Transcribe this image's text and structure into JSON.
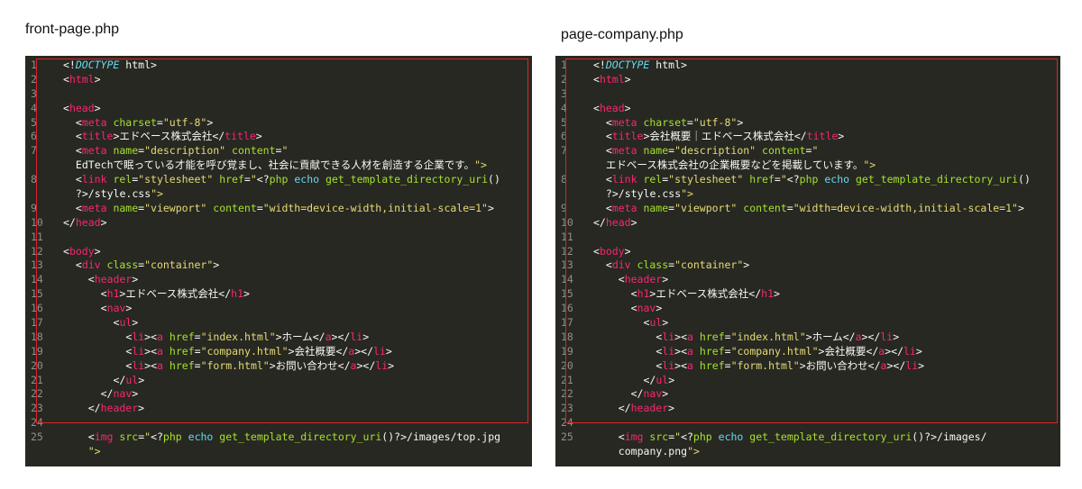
{
  "panels": [
    {
      "title": "front-page.php",
      "lines": [
        {
          "n": "1",
          "t": "<!DOCTYPE html>"
        },
        {
          "n": "2",
          "t": "<html>"
        },
        {
          "n": "3",
          "t": ""
        },
        {
          "n": "4",
          "t": "<head>"
        },
        {
          "n": "5",
          "t": "  <meta charset=\"utf-8\">"
        },
        {
          "n": "6",
          "t": "  <title>エドベース株式会社</title>"
        },
        {
          "n": "7",
          "t": "  <meta name=\"description\" content=\""
        },
        {
          "n": "",
          "t": "  EdTechで眠っている才能を呼び覚まし、社会に貢献できる人材を創造する企業です。\">"
        },
        {
          "n": "8",
          "t": "  <link rel=\"stylesheet\" href=\"<?php echo get_template_directory_uri()"
        },
        {
          "n": "",
          "t": "  ?>/style.css\">"
        },
        {
          "n": "9",
          "t": "  <meta name=\"viewport\" content=\"width=device-width,initial-scale=1\">"
        },
        {
          "n": "10",
          "t": "</head>"
        },
        {
          "n": "11",
          "t": ""
        },
        {
          "n": "12",
          "t": "<body>"
        },
        {
          "n": "13",
          "t": "  <div class=\"container\">"
        },
        {
          "n": "14",
          "t": "    <header>"
        },
        {
          "n": "15",
          "t": "      <h1>エドベース株式会社</h1>"
        },
        {
          "n": "16",
          "t": "      <nav>"
        },
        {
          "n": "17",
          "t": "        <ul>"
        },
        {
          "n": "18",
          "t": "          <li><a href=\"index.html\">ホーム</a></li>"
        },
        {
          "n": "19",
          "t": "          <li><a href=\"company.html\">会社概要</a></li>"
        },
        {
          "n": "20",
          "t": "          <li><a href=\"form.html\">お問い合わせ</a></li>"
        },
        {
          "n": "21",
          "t": "        </ul>"
        },
        {
          "n": "22",
          "t": "      </nav>"
        },
        {
          "n": "23",
          "t": "    </header>"
        },
        {
          "n": "24",
          "t": ""
        },
        {
          "n": "25",
          "t": "    <img src=\"<?php echo get_template_directory_uri()?>/images/top.jpg"
        },
        {
          "n": "",
          "t": "    \">"
        }
      ]
    },
    {
      "title": "page-company.php",
      "lines": [
        {
          "n": "1",
          "t": "<!DOCTYPE html>"
        },
        {
          "n": "2",
          "t": "<html>"
        },
        {
          "n": "3",
          "t": ""
        },
        {
          "n": "4",
          "t": "<head>"
        },
        {
          "n": "5",
          "t": "  <meta charset=\"utf-8\">"
        },
        {
          "n": "6",
          "t": "  <title>会社概要｜エドベース株式会社</title>"
        },
        {
          "n": "7",
          "t": "  <meta name=\"description\" content=\""
        },
        {
          "n": "",
          "t": "  エドベース株式会社の企業概要などを掲載しています。\">"
        },
        {
          "n": "8",
          "t": "  <link rel=\"stylesheet\" href=\"<?php echo get_template_directory_uri()"
        },
        {
          "n": "",
          "t": "  ?>/style.css\">"
        },
        {
          "n": "9",
          "t": "  <meta name=\"viewport\" content=\"width=device-width,initial-scale=1\">"
        },
        {
          "n": "10",
          "t": "</head>"
        },
        {
          "n": "11",
          "t": ""
        },
        {
          "n": "12",
          "t": "<body>"
        },
        {
          "n": "13",
          "t": "  <div class=\"container\">"
        },
        {
          "n": "14",
          "t": "    <header>"
        },
        {
          "n": "15",
          "t": "      <h1>エドベース株式会社</h1>"
        },
        {
          "n": "16",
          "t": "      <nav>"
        },
        {
          "n": "17",
          "t": "        <ul>"
        },
        {
          "n": "18",
          "t": "          <li><a href=\"index.html\">ホーム</a></li>"
        },
        {
          "n": "19",
          "t": "          <li><a href=\"company.html\">会社概要</a></li>"
        },
        {
          "n": "20",
          "t": "          <li><a href=\"form.html\">お問い合わせ</a></li>"
        },
        {
          "n": "21",
          "t": "        </ul>"
        },
        {
          "n": "22",
          "t": "      </nav>"
        },
        {
          "n": "23",
          "t": "    </header>"
        },
        {
          "n": "24",
          "t": ""
        },
        {
          "n": "25",
          "t": "    <img src=\"<?php echo get_template_directory_uri()?>/images/"
        },
        {
          "n": "",
          "t": "    company.png\">"
        }
      ]
    }
  ],
  "colors": {
    "editor_bg": "#272822",
    "selection_border": "#d8262a",
    "tag": "#f92672",
    "attr": "#a6e22e",
    "string": "#e6db74",
    "keyword": "#66d9ef"
  }
}
